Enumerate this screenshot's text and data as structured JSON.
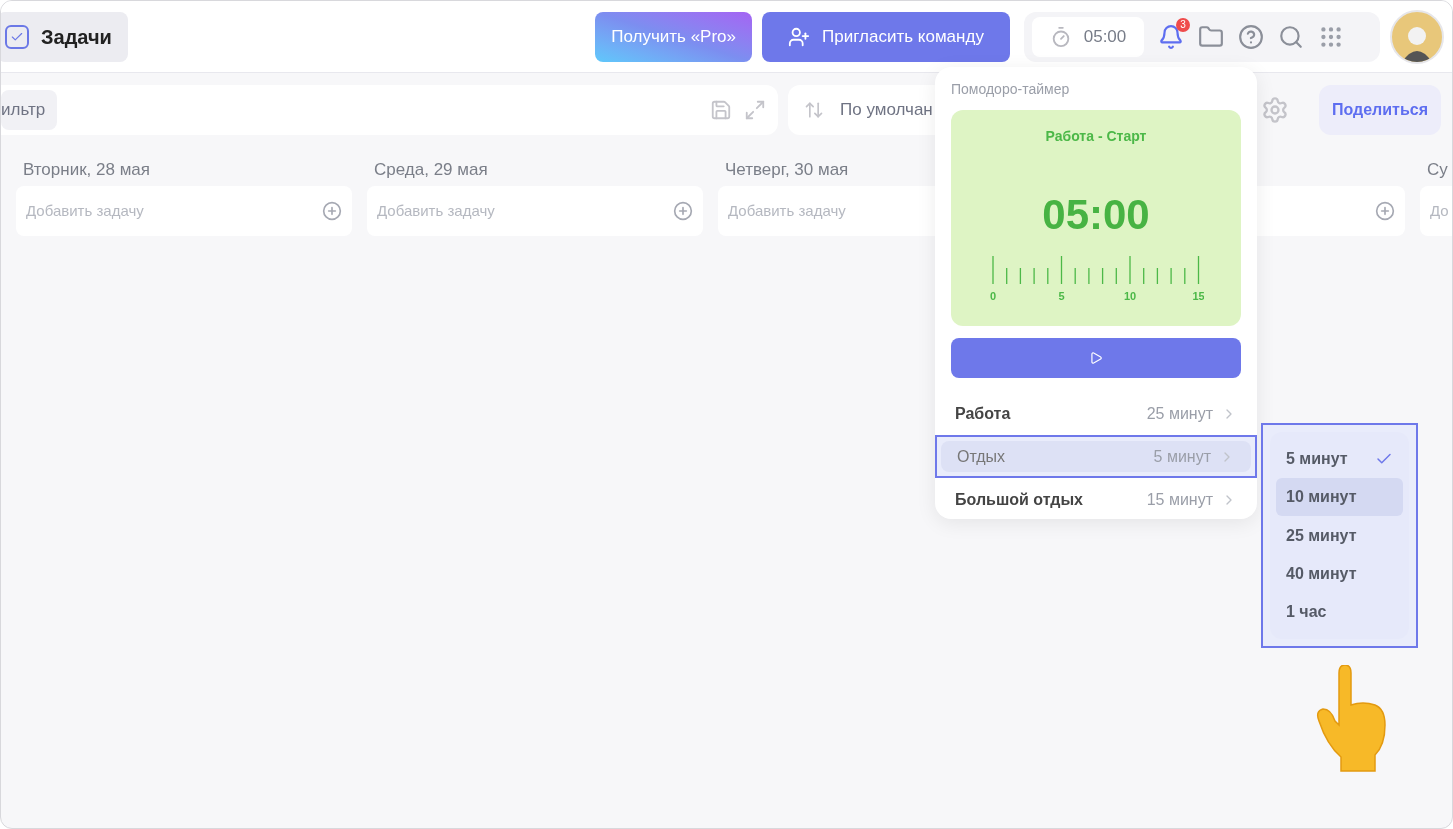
{
  "header": {
    "app_title": "Задачи",
    "pro_button": "Получить «Pro»",
    "invite_button": "Пригласить команду",
    "timer": "05:00",
    "notification_count": "3"
  },
  "toolbar": {
    "filter": "ильтр",
    "sort": "По умолчан",
    "share": "Поделиться"
  },
  "columns": [
    {
      "title": "Вторник, 28 мая",
      "placeholder": "Добавить задачу"
    },
    {
      "title": "Среда, 29 мая",
      "placeholder": "Добавить задачу"
    },
    {
      "title": "Четверг, 30 мая",
      "placeholder": "Добавить задачу"
    },
    {},
    {
      "title": "Су",
      "placeholder": "До"
    }
  ],
  "pomodoro": {
    "title": "Помодоро-таймер",
    "phase": "Работа - Старт",
    "time": "05:00",
    "ruler_labels": [
      "0",
      "5",
      "10",
      "15"
    ],
    "rows": [
      {
        "label": "Работа",
        "value": "25 минут",
        "selected": false
      },
      {
        "label": "Отдых",
        "value": "5 минут",
        "selected": true
      },
      {
        "label": "Большой отдых",
        "value": "15 минут",
        "selected": false
      }
    ]
  },
  "duration_menu": [
    {
      "label": "5 минут",
      "selected": true,
      "hovered": false
    },
    {
      "label": "10 минут",
      "selected": false,
      "hovered": true
    },
    {
      "label": "25 минут",
      "selected": false,
      "hovered": false
    },
    {
      "label": "40 минут",
      "selected": false,
      "hovered": false
    },
    {
      "label": "1 час",
      "selected": false,
      "hovered": false
    }
  ]
}
